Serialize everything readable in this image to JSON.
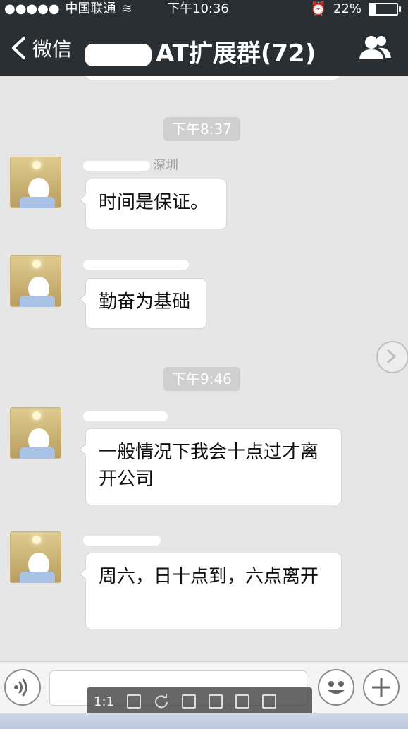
{
  "status": {
    "signal": "●●●●●",
    "carrier": "中国联通",
    "wifi": "≋",
    "time": "下午10:36",
    "alarm": "⏰",
    "battery": "22%"
  },
  "nav": {
    "back_label": "微信",
    "title": "AT扩展群(72)"
  },
  "messages": [
    {
      "time": "下午8:37"
    },
    {
      "sender": "深圳",
      "text": "时间是保证。"
    },
    {
      "sender": "",
      "text": "勤奋为基础"
    },
    {
      "time": "下午9:46"
    },
    {
      "sender": "",
      "text": "一般情况下我会十点过才离开公司"
    },
    {
      "sender": "",
      "text": "周六，日十点到，六点离开"
    }
  ],
  "viewer": {
    "ratio": "1:1"
  },
  "colors": {
    "nav_bg": "#2a2f33",
    "chat_bg": "#e6e6e6",
    "time_chip": "#cfcfcf"
  }
}
